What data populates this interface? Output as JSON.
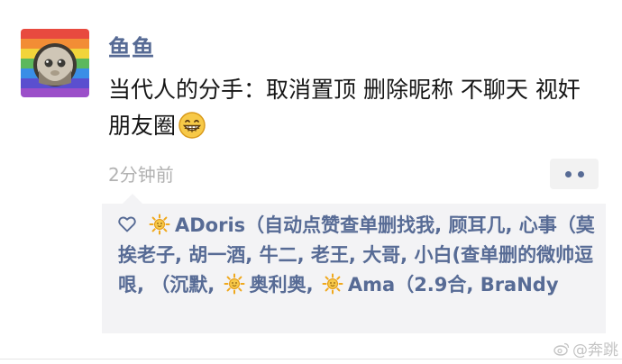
{
  "post": {
    "username": "鱼鱼",
    "text": "当代人的分手：取消置顶  删除昵称 不聊天 视奸朋友圈",
    "emoji_icon": "grinning-face-emoji",
    "timestamp": "2分钟前"
  },
  "likes": {
    "heart_icon": "heart-outline-icon",
    "sun_icon": "sun-emoji-icon",
    "segments": [
      {
        "text": "ADoris（自动点赞查单删找我, ",
        "sun": true
      },
      {
        "text": "顾耳几, ",
        "sun": false
      },
      {
        "text": "心事（莫挨老子, ",
        "sun": false
      },
      {
        "text": "胡一酒, ",
        "sun": false
      },
      {
        "text": "牛二, ",
        "sun": false
      },
      {
        "text": "老王, ",
        "sun": false
      },
      {
        "text": "大哥, ",
        "sun": false
      },
      {
        "text": "小白(查单删的微帅逗哏, ",
        "sun": false
      },
      {
        "text": "（沉默, ",
        "sun": false
      },
      {
        "text": "奥利奥, ",
        "sun": true
      },
      {
        "text": "Ama（2.9合, ",
        "sun": true
      },
      {
        "text": "BraNdy",
        "sun": false
      }
    ]
  },
  "watermark": {
    "text": "@奔跳",
    "icon": "weibo-logo-icon"
  },
  "colors": {
    "link_blue": "#576b95",
    "panel_bg": "#f3f3f5",
    "timestamp_gray": "#b2b2b2"
  }
}
